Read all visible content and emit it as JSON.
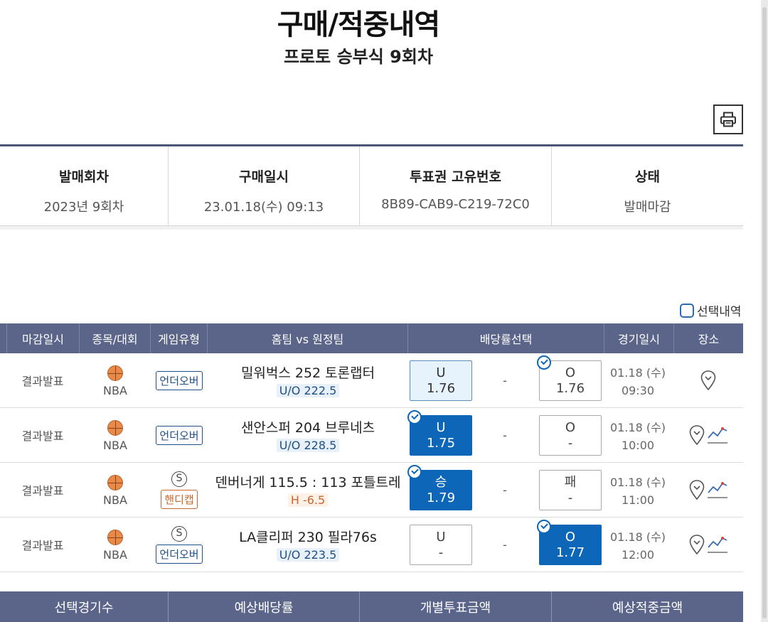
{
  "page": {
    "title": "구매/적중내역",
    "subtitle": "프로토 승부식 9회차",
    "print_icon": "printer-icon"
  },
  "info": [
    {
      "label": "발매회차",
      "value": "2023년 9회차"
    },
    {
      "label": "구매일시",
      "value": "23.01.18(수) 09:13"
    },
    {
      "label": "투표권 고유번호",
      "value": "8B89-CAB9-C219-72C0"
    },
    {
      "label": "상태",
      "value": "발매마감"
    }
  ],
  "selection_history_label": "선택내역",
  "table": {
    "headers": [
      "마감일시",
      "종목/대회",
      "게임유형",
      "홈팀 vs 원정팀",
      "배당률선택",
      "경기일시",
      "장소"
    ],
    "rows": [
      {
        "deadline": "결과발표",
        "sport": "NBA",
        "s_badge": "",
        "game_type": "언더오버",
        "game_type_kind": "uo",
        "home": "밀워벅스",
        "score": "252",
        "away": "토론랩터",
        "sub": "U/O 222.5",
        "left_label": "U",
        "left_odds": "1.76",
        "left_state": "light",
        "dash": "-",
        "right_label": "O",
        "right_odds": "1.76",
        "right_state": "checked",
        "date": "01.18 (수)",
        "time": "09:30",
        "has_chart": false
      },
      {
        "deadline": "결과발표",
        "sport": "NBA",
        "s_badge": "",
        "game_type": "언더오버",
        "game_type_kind": "uo",
        "home": "샌안스퍼",
        "score": "204",
        "away": "브루네츠",
        "sub": "U/O 228.5",
        "left_label": "U",
        "left_odds": "1.75",
        "left_state": "selected",
        "dash": "-",
        "right_label": "O",
        "right_odds": "-",
        "right_state": "normal",
        "date": "01.18 (수)",
        "time": "10:00",
        "has_chart": true
      },
      {
        "deadline": "결과발표",
        "sport": "NBA",
        "s_badge": "S",
        "game_type": "핸디캡",
        "game_type_kind": "hc",
        "home": "덴버너게",
        "score": "115.5 : 113",
        "away": "포틀트레",
        "sub": "H -6.5",
        "left_label": "승",
        "left_odds": "1.79",
        "left_state": "selected",
        "dash": "-",
        "right_label": "패",
        "right_odds": "-",
        "right_state": "normal",
        "date": "01.18 (수)",
        "time": "11:00",
        "has_chart": true
      },
      {
        "deadline": "결과발표",
        "sport": "NBA",
        "s_badge": "S",
        "game_type": "언더오버",
        "game_type_kind": "uo",
        "home": "LA클리퍼",
        "score": "230",
        "away": "필라76s",
        "sub": "U/O 223.5",
        "left_label": "U",
        "left_odds": "-",
        "left_state": "normal",
        "dash": "-",
        "right_label": "O",
        "right_odds": "1.77",
        "right_state": "selected",
        "date": "01.18 (수)",
        "time": "12:00",
        "has_chart": true
      }
    ]
  },
  "summary_headers": [
    "선택경기수",
    "예상배당률",
    "개별투표금액",
    "예상적중금액"
  ],
  "colors": {
    "header_bg": "#5a6589",
    "selected_blue": "#0e66b8",
    "handicap_orange": "#c9672c",
    "underover_navy": "#1f4f84"
  }
}
